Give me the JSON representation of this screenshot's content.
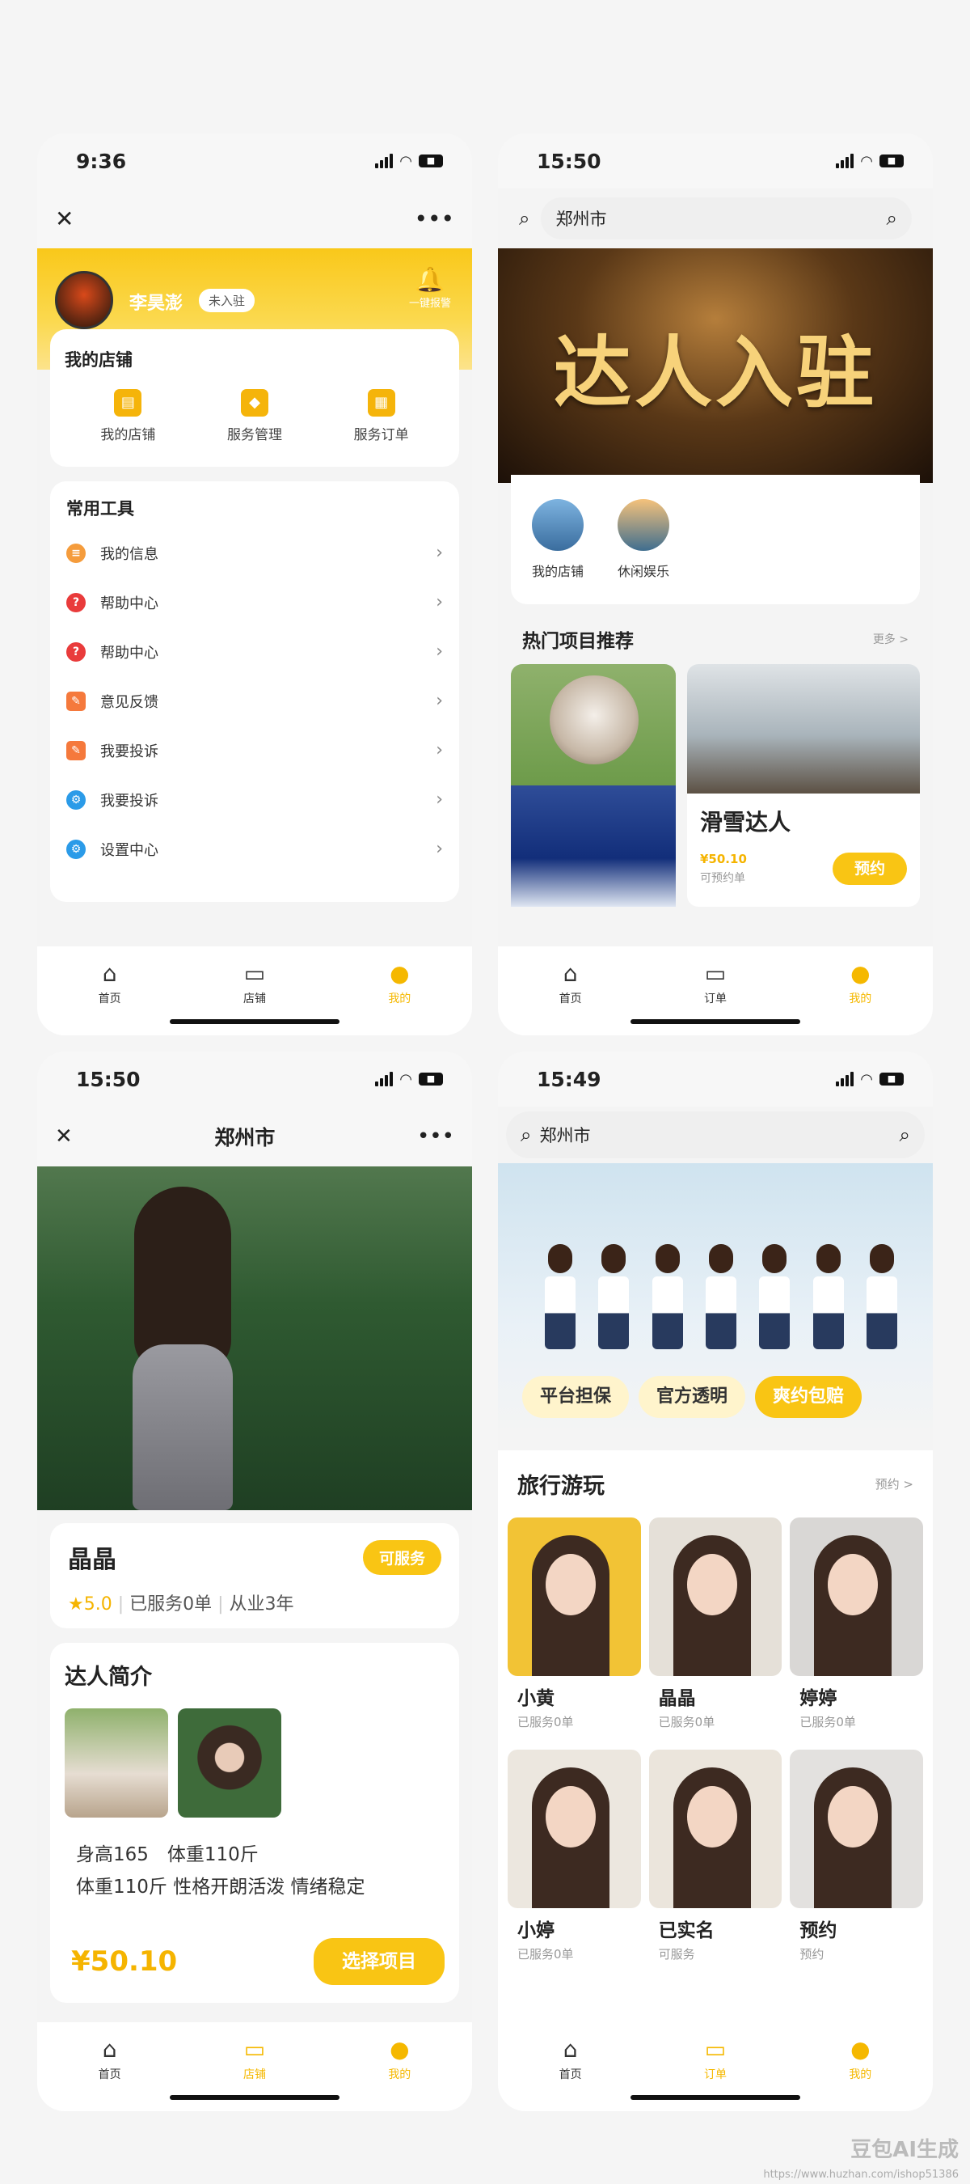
{
  "p1": {
    "time": "9:36",
    "close": "✕",
    "more": "•••",
    "username": "李昊澎",
    "badge": "未入驻",
    "bell_label": "一键报警",
    "shop": {
      "title": "我的店铺",
      "items": [
        {
          "label": "我的店铺"
        },
        {
          "label": "服务管理"
        },
        {
          "label": "服务订单"
        }
      ]
    },
    "tools": {
      "title": "常用工具",
      "items": [
        {
          "label": "我的信息",
          "color": "#f59c3c"
        },
        {
          "label": "帮助中心",
          "color": "#e93b3b"
        },
        {
          "label": "帮助中心",
          "color": "#e93b3b"
        },
        {
          "label": "意见反馈",
          "color": "#f5793c"
        },
        {
          "label": "我要投诉",
          "color": "#f5793c"
        },
        {
          "label": "我要投诉",
          "color": "#2b9be8"
        },
        {
          "label": "设置中心",
          "color": "#2b9be8"
        }
      ]
    },
    "tabs": [
      "首页",
      "店铺",
      "我的"
    ]
  },
  "p2": {
    "time": "15:50",
    "city": "郑州市",
    "banner": "达人入驻",
    "cats": [
      "我的店铺",
      "休闲娱乐"
    ],
    "hot_title": "热门项目推荐",
    "hot_more": "更多 >",
    "card": {
      "name": "滑雪达人",
      "price": "¥50.10",
      "sub": "可预约单",
      "btn": "预约"
    },
    "tabs": [
      "首页",
      "订单",
      "我的"
    ]
  },
  "p3": {
    "time": "15:50",
    "city": "郑州市",
    "name": "晶晶",
    "tag": "可服务",
    "rating": "★5.0",
    "served": "已服务0单",
    "years": "从业3年",
    "intro_title": "达人简介",
    "line1": "身高165　体重110斤",
    "line2": "体重110斤 性格开朗活泼 情绪稳定",
    "price": "¥50.10",
    "btn": "选择项目",
    "tabs": [
      "首页",
      "店铺",
      "我的"
    ]
  },
  "p4": {
    "time": "15:49",
    "city": "郑州市",
    "pills": [
      "平台担保",
      "官方透明",
      "爽约包赔"
    ],
    "travel_title": "旅行游玩",
    "travel_more": "预约 >",
    "people": [
      {
        "name": "小黄",
        "sub": "已服务0单",
        "bg": "#f2c335"
      },
      {
        "name": "晶晶",
        "sub": "已服务0单",
        "bg": "#e5e0d8"
      },
      {
        "name": "婷婷",
        "sub": "已服务0单",
        "bg": "#d9d7d5"
      },
      {
        "name": "小婷",
        "sub": "已服务0单",
        "bg": "#ece7df"
      },
      {
        "name": "已实名",
        "sub": "可服务",
        "bg": "#ebe5dc"
      },
      {
        "name": "预约",
        "sub": "预约",
        "bg": "#e3e1df"
      }
    ],
    "tabs": [
      "首页",
      "订单",
      "我的"
    ]
  },
  "watermark": "豆包AI生成",
  "url": "https://www.huzhan.com/ishop51386"
}
